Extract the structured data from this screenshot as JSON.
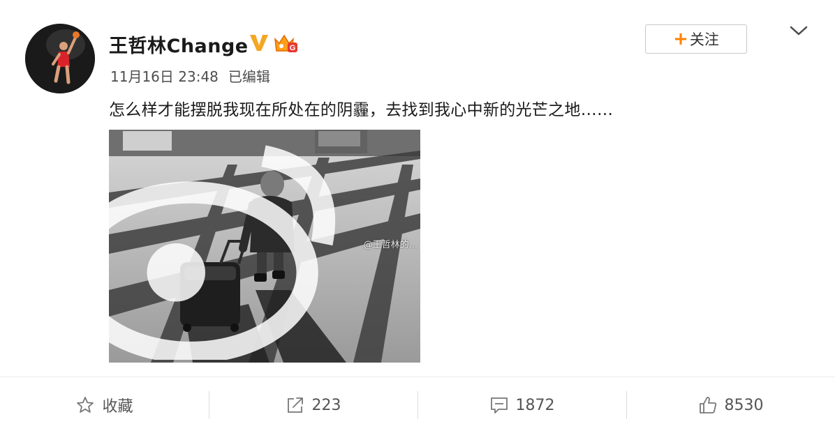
{
  "post": {
    "author": {
      "name": "王哲林Change",
      "verified_icon": "verified-v-icon",
      "badge_icon": "vip-crown-icon"
    },
    "time": "11月16日 23:48",
    "edited_label": "已编辑",
    "text": "怎么样才能摆脱我现在所处在的阴霾，去找到我心中新的光芒之地……",
    "follow_button": {
      "plus": "+",
      "label": "关注"
    },
    "more_icon": "chevron-down-icon",
    "image": {
      "watermark": "@王哲林的..."
    },
    "actions": {
      "favorite": {
        "icon": "star-icon",
        "label": "收藏"
      },
      "repost": {
        "icon": "share-icon",
        "count": "223"
      },
      "comment": {
        "icon": "comment-icon",
        "count": "1872"
      },
      "like": {
        "icon": "thumbs-up-icon",
        "count": "8530"
      }
    }
  },
  "colors": {
    "accent_orange": "#ff8200",
    "verified_gold": "#f5a623",
    "text_dark": "#1a1a1a",
    "text_gray": "#4d4d4d"
  }
}
